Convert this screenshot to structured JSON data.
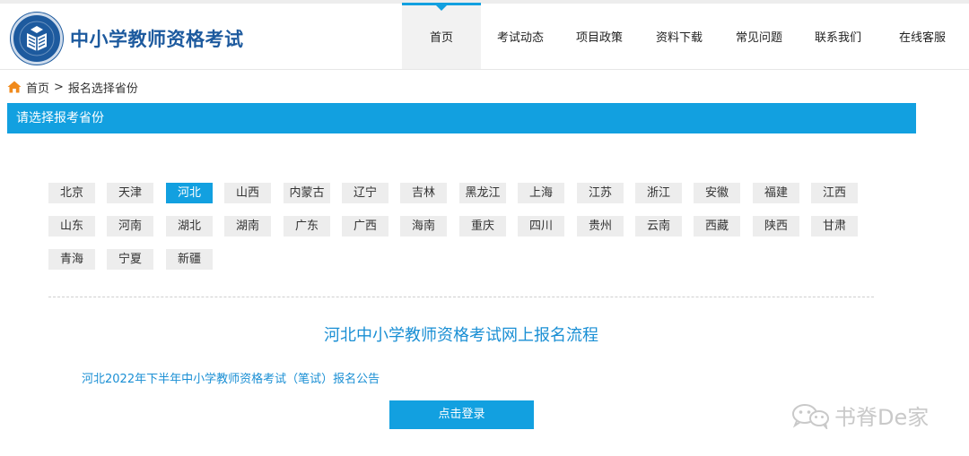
{
  "header": {
    "site_title": "中小学教师资格考试",
    "nav": [
      {
        "label": "首页",
        "active": true
      },
      {
        "label": "考试动态"
      },
      {
        "label": "项目政策"
      },
      {
        "label": "资料下载"
      },
      {
        "label": "常见问题"
      },
      {
        "label": "联系我们"
      },
      {
        "label": "在线客服"
      }
    ]
  },
  "breadcrumb": {
    "home": "首页",
    "separator": ">",
    "current": "报名选择省份"
  },
  "section": {
    "title": "请选择报考省份"
  },
  "provinces": {
    "selected": "河北",
    "items": [
      "北京",
      "天津",
      "河北",
      "山西",
      "内蒙古",
      "辽宁",
      "吉林",
      "黑龙江",
      "上海",
      "江苏",
      "浙江",
      "安徽",
      "福建",
      "江西",
      "山东",
      "河南",
      "湖北",
      "湖南",
      "广东",
      "广西",
      "海南",
      "重庆",
      "四川",
      "贵州",
      "云南",
      "西藏",
      "陕西",
      "甘肃",
      "青海",
      "宁夏",
      "新疆"
    ]
  },
  "main": {
    "process_title": "河北中小学教师资格考试网上报名流程",
    "notice_link": "河北2022年下半年中小学教师资格考试（笔试）报名公告",
    "login_button": "点击登录"
  },
  "watermark": {
    "text": "书脊De家"
  },
  "colors": {
    "accent": "#12a0e0",
    "brand": "#1d5a9e",
    "link": "#1a8fd4",
    "chip": "#ededed"
  },
  "icons": {
    "logo": "book-emblem-icon",
    "breadcrumb": "home-icon",
    "watermark": "wechat-icon"
  }
}
